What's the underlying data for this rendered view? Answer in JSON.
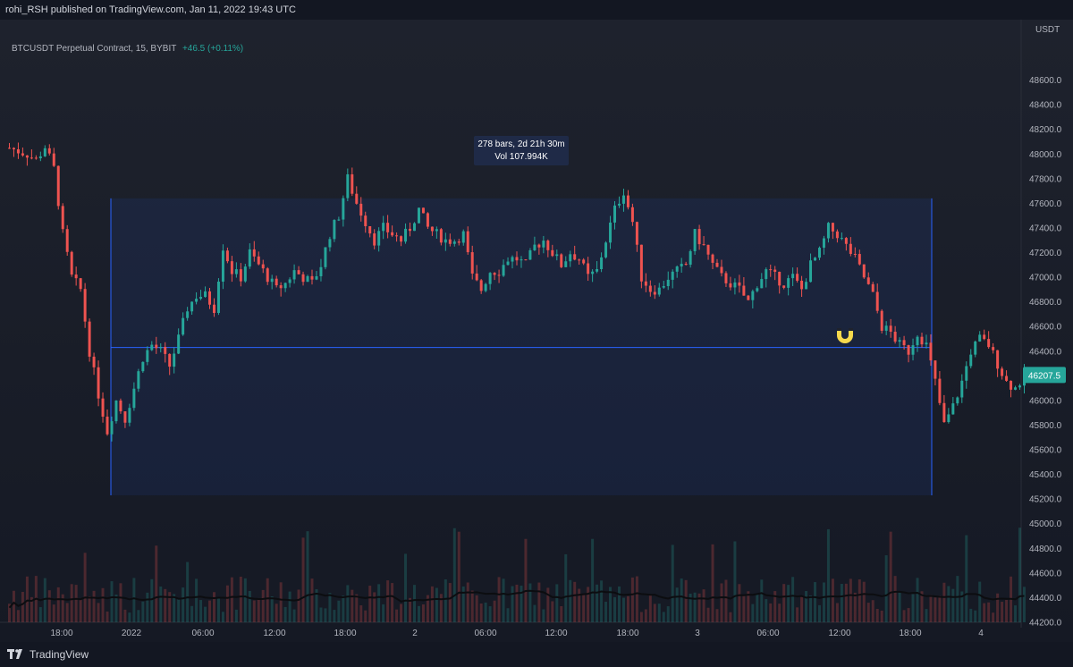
{
  "header": {
    "published": "rohi_RSH published on TradingView.com, Jan 11, 2022 19:43 UTC"
  },
  "legend": {
    "symbol": "BTCUSDT Perpetual Contract, 15, BYBIT",
    "change": "+46.5 (+0.11%)"
  },
  "footer": {
    "brand": "TradingView"
  },
  "colors": {
    "background": "#1e222d",
    "up": "#26a69a",
    "down": "#ef5350",
    "range_box": "#2962ff",
    "last_price": "#26a69a"
  },
  "chart_data": {
    "type": "candlestick",
    "y_unit": "USDT",
    "ylim": [
      45000,
      48800
    ],
    "y_ticks": [
      48600,
      48400,
      48200,
      48000,
      47800,
      47600,
      47400,
      47200,
      47000,
      46800,
      46600,
      46400,
      46200,
      46000,
      45800,
      45600,
      45400,
      45200,
      45000,
      44800,
      44600,
      44400,
      44200
    ],
    "x_ticks": [
      "18:00",
      "2022",
      "06:00",
      "12:00",
      "18:00",
      "2",
      "06:00",
      "12:00",
      "18:00",
      "3",
      "06:00",
      "12:00",
      "18:00",
      "4"
    ],
    "last_price": "46207.5",
    "range_annotation": {
      "text_line1": "278 bars, 2d 21h 30m",
      "text_line2": "Vol 107.994K",
      "price_from": 46430,
      "price_to": 47640,
      "price_bottom": 45230
    },
    "price_path": [
      [
        0,
        48050
      ],
      [
        4,
        48000
      ],
      [
        6,
        47950
      ],
      [
        8,
        48060
      ],
      [
        10,
        47880
      ],
      [
        12,
        47350
      ],
      [
        14,
        47000
      ],
      [
        16,
        46900
      ],
      [
        18,
        46400
      ],
      [
        20,
        46050
      ],
      [
        22,
        45750
      ],
      [
        24,
        46000
      ],
      [
        26,
        45850
      ],
      [
        28,
        46100
      ],
      [
        30,
        46350
      ],
      [
        32,
        46450
      ],
      [
        34,
        46400
      ],
      [
        36,
        46280
      ],
      [
        38,
        46500
      ],
      [
        40,
        46750
      ],
      [
        42,
        46850
      ],
      [
        44,
        46850
      ],
      [
        46,
        46750
      ],
      [
        48,
        47250
      ],
      [
        50,
        47050
      ],
      [
        52,
        47000
      ],
      [
        54,
        47200
      ],
      [
        56,
        47100
      ],
      [
        58,
        47000
      ],
      [
        60,
        46900
      ],
      [
        62,
        46950
      ],
      [
        64,
        47050
      ],
      [
        66,
        47000
      ],
      [
        68,
        46950
      ],
      [
        70,
        47100
      ],
      [
        72,
        47350
      ],
      [
        74,
        47500
      ],
      [
        76,
        47800
      ],
      [
        78,
        47600
      ],
      [
        80,
        47450
      ],
      [
        82,
        47300
      ],
      [
        84,
        47400
      ],
      [
        86,
        47350
      ],
      [
        88,
        47300
      ],
      [
        90,
        47400
      ],
      [
        92,
        47550
      ],
      [
        94,
        47400
      ],
      [
        96,
        47350
      ],
      [
        98,
        47300
      ],
      [
        100,
        47300
      ],
      [
        102,
        47350
      ],
      [
        104,
        47000
      ],
      [
        106,
        46900
      ],
      [
        108,
        47050
      ],
      [
        110,
        47050
      ],
      [
        112,
        47150
      ],
      [
        114,
        47150
      ],
      [
        116,
        47100
      ],
      [
        118,
        47250
      ],
      [
        120,
        47300
      ],
      [
        122,
        47200
      ],
      [
        124,
        47100
      ],
      [
        126,
        47200
      ],
      [
        128,
        47150
      ],
      [
        130,
        47000
      ],
      [
        132,
        47050
      ],
      [
        134,
        47300
      ],
      [
        136,
        47550
      ],
      [
        138,
        47700
      ],
      [
        140,
        47450
      ],
      [
        142,
        47000
      ],
      [
        144,
        46900
      ],
      [
        146,
        46900
      ],
      [
        148,
        47000
      ],
      [
        150,
        47050
      ],
      [
        152,
        47100
      ],
      [
        154,
        47350
      ],
      [
        156,
        47250
      ],
      [
        158,
        47100
      ],
      [
        160,
        47000
      ],
      [
        162,
        46950
      ],
      [
        164,
        46900
      ],
      [
        166,
        46800
      ],
      [
        168,
        46950
      ],
      [
        170,
        47050
      ],
      [
        172,
        47000
      ],
      [
        174,
        46950
      ],
      [
        176,
        47000
      ],
      [
        178,
        46900
      ],
      [
        180,
        47100
      ],
      [
        182,
        47200
      ],
      [
        184,
        47400
      ],
      [
        186,
        47350
      ],
      [
        188,
        47250
      ],
      [
        190,
        47150
      ],
      [
        192,
        47000
      ],
      [
        194,
        46850
      ],
      [
        196,
        46600
      ],
      [
        198,
        46550
      ],
      [
        200,
        46450
      ],
      [
        202,
        46400
      ],
      [
        204,
        46550
      ],
      [
        206,
        46450
      ],
      [
        208,
        46150
      ],
      [
        210,
        45800
      ],
      [
        212,
        45950
      ],
      [
        214,
        46150
      ],
      [
        216,
        46400
      ],
      [
        218,
        46500
      ],
      [
        220,
        46450
      ],
      [
        222,
        46300
      ],
      [
        224,
        46150
      ],
      [
        226,
        46100
      ],
      [
        228,
        46200
      ]
    ]
  }
}
